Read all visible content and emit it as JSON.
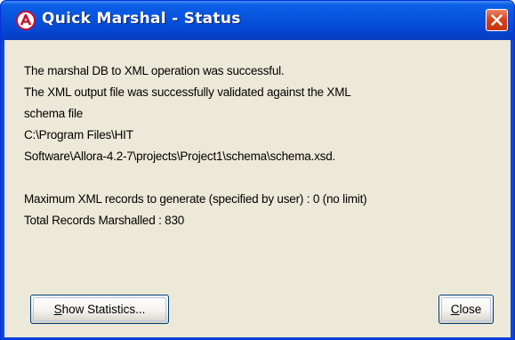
{
  "window": {
    "title": "Quick Marshal - Status",
    "icon": "allora-app-icon",
    "close_icon": "close-icon"
  },
  "message": {
    "lines": [
      "The marshal DB to XML operation was successful.",
      "The XML output file was successfully validated against the XML",
      "schema file",
      "C:\\Program Files\\HIT",
      "Software\\Allora-4.2-7\\projects\\Project1\\schema\\schema.xsd.",
      "Maximum XML records to generate (specified by user) : 0 (no limit)",
      "Total Records Marshalled : 830"
    ]
  },
  "buttons": {
    "show_statistics": {
      "label": "Show Statistics...",
      "mnemonic": "S",
      "rest": "how Statistics..."
    },
    "close": {
      "label": "Close",
      "mnemonic": "C",
      "rest": "lose"
    }
  }
}
